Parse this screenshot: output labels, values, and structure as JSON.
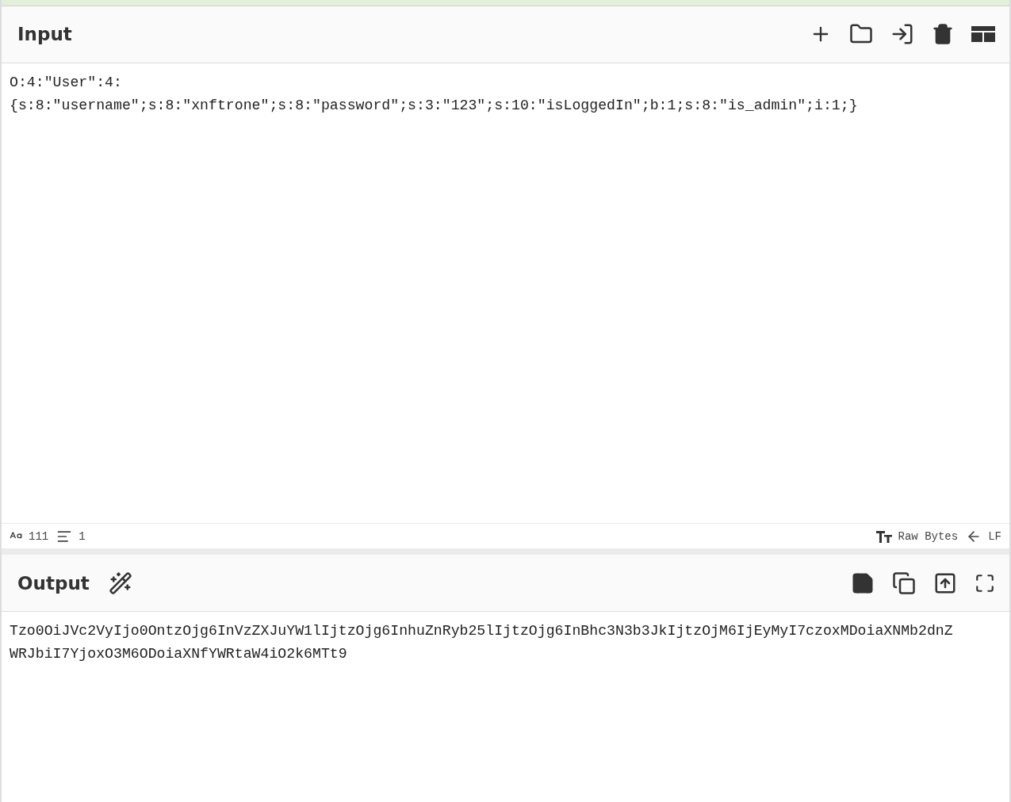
{
  "input": {
    "title": "Input",
    "lines": [
      "O:4:\"User\":4:",
      "{s:8:\"username\";s:8:\"xnftrone\";s:8:\"password\";s:3:\"123\";s:10:\"isLoggedIn\";b:1;s:8:\"is_admin\";i:1;}"
    ],
    "status": {
      "chars": "111",
      "lines": "1",
      "encoding": "Raw Bytes",
      "eol": "LF"
    }
  },
  "output": {
    "title": "Output",
    "lines": [
      "Tzo0OiJVc2VyIjo0OntzOjg6InVzZXJuYW1lIjtzOjg6InhuZnRyb25lIjtzOjg6InBhc3N3b3JkIjtzOjM6IjEyMyI7czoxMDoiaXNMb2dnZ",
      "WRJbiI7YjoxO3M6ODoiaXNfYWRtaW4iO2k6MTt9"
    ]
  }
}
